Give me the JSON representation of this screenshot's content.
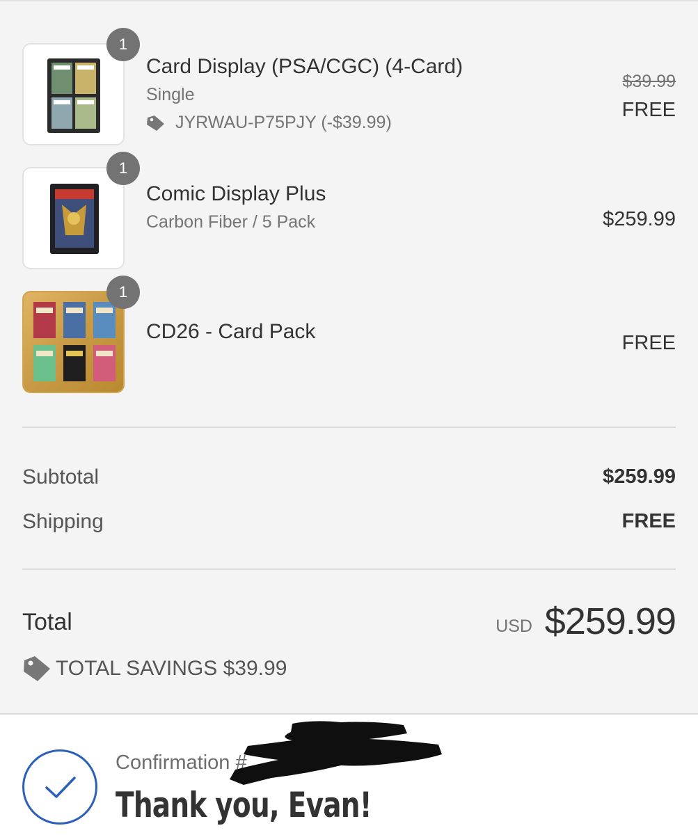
{
  "line_items": [
    {
      "name": "Card Display (PSA/CGC) (4-Card)",
      "variant": "Single",
      "quantity": "1",
      "discount_code": "JYRWAU-P75PJY (-$39.99)",
      "original_price": "$39.99",
      "price": "FREE",
      "discount_icon": "tag-icon",
      "image": "card-display-thumbnail"
    },
    {
      "name": "Comic Display Plus",
      "variant": "Carbon Fiber / 5 Pack",
      "quantity": "1",
      "price": "$259.99",
      "image": "comic-display-thumbnail"
    },
    {
      "name": "CD26 - Card Pack",
      "quantity": "1",
      "price": "FREE",
      "image": "card-pack-thumbnail"
    }
  ],
  "totals": {
    "subtotal_label": "Subtotal",
    "subtotal_value": "$259.99",
    "shipping_label": "Shipping",
    "shipping_value": "FREE",
    "total_label": "Total",
    "currency": "USD",
    "total_value": "$259.99",
    "savings_text": "TOTAL SAVINGS $39.99",
    "savings_icon": "tag-icon"
  },
  "confirmation": {
    "number_label": "Confirmation #",
    "thank_you": "Thank you, Evan!",
    "icon": "checkmark-circle-icon"
  },
  "colors": {
    "background": "#f4f4f4",
    "badge": "#737373",
    "accent": "#2c5fb8"
  }
}
